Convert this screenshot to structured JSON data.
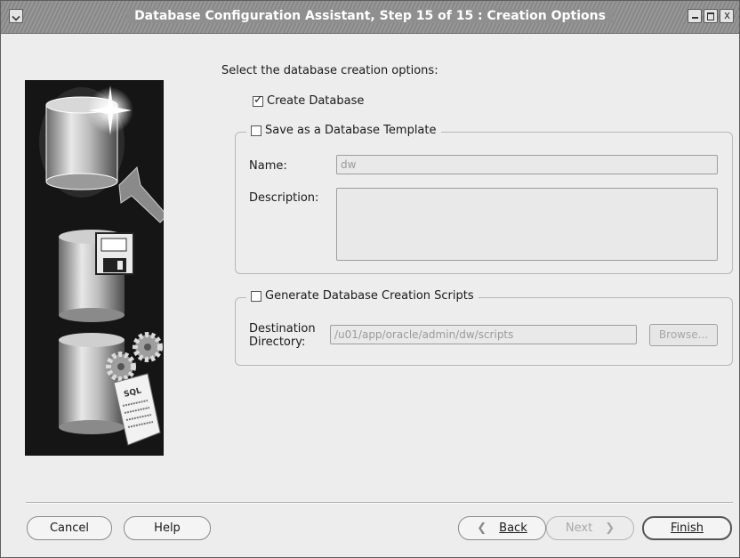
{
  "window": {
    "title": "Database Configuration Assistant, Step 15 of 15 : Creation Options"
  },
  "prompt": "Select the database creation options:",
  "options": {
    "create_database": {
      "label": "Create Database",
      "checked": true
    },
    "save_template": {
      "label": "Save as a Database Template",
      "checked": false,
      "name_label": "Name:",
      "name_value": "dw",
      "description_label": "Description:",
      "description_value": ""
    },
    "generate_scripts": {
      "label": "Generate Database Creation Scripts",
      "checked": false,
      "dest_label_line1": "Destination",
      "dest_label_line2": "Directory:",
      "dest_value": "/u01/app/oracle/admin/dw/scripts",
      "browse_label": "Browse..."
    }
  },
  "buttons": {
    "cancel": "Cancel",
    "help": "Help",
    "back_arrow": "❮",
    "back": "Back",
    "next": "Next",
    "next_arrow": "❯",
    "finish": "Finish"
  },
  "icons": [
    "menu-icon",
    "minimize-icon",
    "maximize-icon",
    "close-icon",
    "database-illustration-icon",
    "floppy-disk-icon",
    "gear-icon",
    "sql-scroll-icon"
  ]
}
